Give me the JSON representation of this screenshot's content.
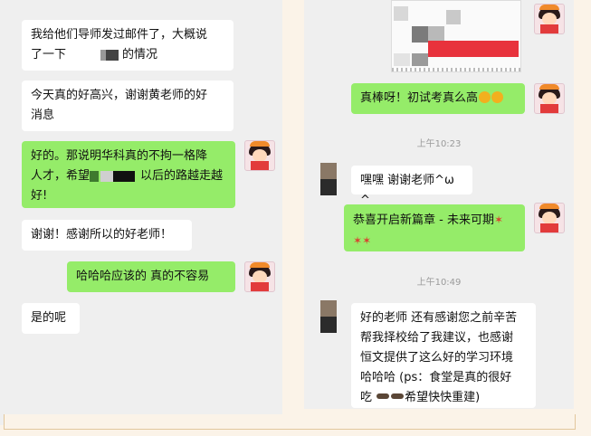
{
  "left_chat": {
    "messages": [
      {
        "side": "incoming",
        "line1": "我给他们导师发过邮件了，大概说",
        "line2a": "了一下",
        "line2b": "的情况"
      },
      {
        "side": "incoming",
        "line1": "今天真的好高兴，谢谢黄老师的好",
        "line2": "消息"
      },
      {
        "side": "outgoing",
        "line1": "好的。那说明华科真的不拘一格降",
        "line2": "人才，希望",
        "line2b": "以后的路越走越",
        "line3": "好!"
      },
      {
        "side": "incoming",
        "text": "谢谢！感谢所以的好老师！"
      },
      {
        "side": "outgoing",
        "text": "哈哈哈应该的 真的不容易"
      },
      {
        "side": "incoming",
        "text": "是的呢"
      }
    ]
  },
  "right_chat": {
    "msg_great": "真棒呀！初试考真么高",
    "time1": "上午10:23",
    "msg_thanks": "嘿嘿 谢谢老师^ω^",
    "msg_newchapter": "恭喜开启新篇章 - 未来可期",
    "time2": "上午10:49",
    "msg_long": {
      "line1": "好的老师 还有感谢您之前辛苦",
      "line2": "帮我择校给了我建议，也感谢",
      "line3": "恒文提供了这么好的学习环境",
      "line4": "哈哈哈 (ps：食堂是真的很好",
      "line5a": "吃",
      "line5b": "希望快快重建)"
    }
  },
  "colors": {
    "outgoing_bubble": "#95ec69",
    "incoming_bubble": "#ffffff",
    "chat_background": "#efefef",
    "page_background": "#fbf3e8"
  },
  "icons": {
    "teacher_avatar": "cartoon-girl-avatar",
    "student_avatar": "mosaic-avatar",
    "emoji_great": "flower-emoji",
    "emoji_celebrate": "party-popper-emoji",
    "emoji_point": "pointing-hand-emoji"
  }
}
